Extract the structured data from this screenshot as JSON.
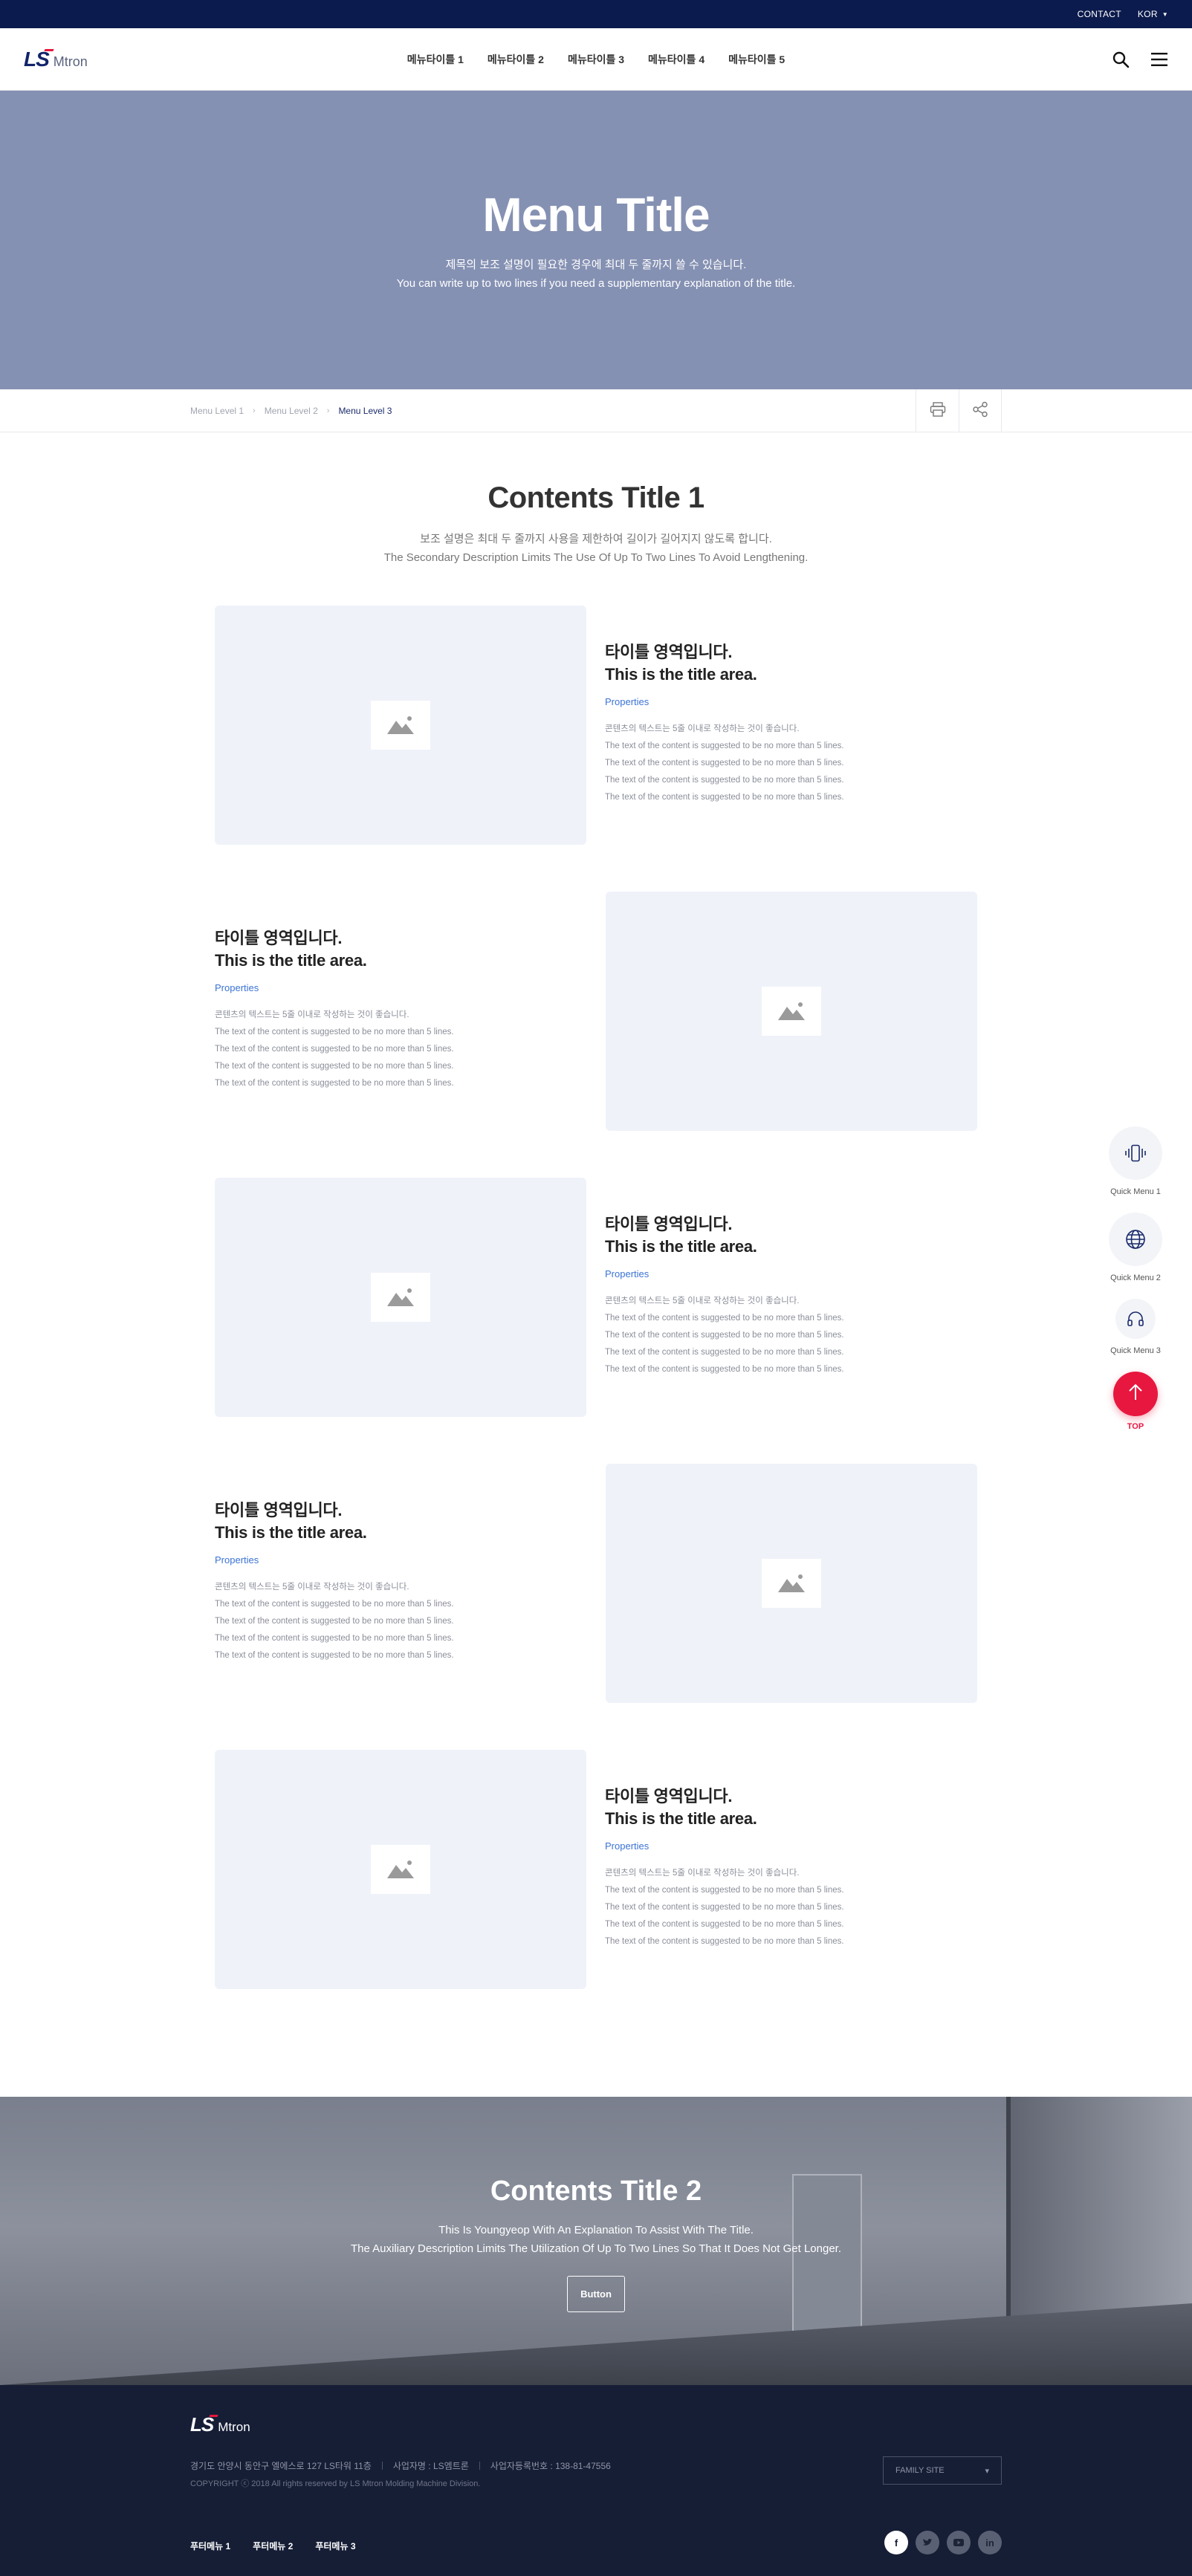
{
  "topbar": {
    "contact": "CONTACT",
    "language": "KOR"
  },
  "header": {
    "logo_mark": "LS",
    "logo_name": "Mtron",
    "menu": [
      "메뉴타이틀 1",
      "메뉴타이틀 2",
      "메뉴타이틀 3",
      "메뉴타이틀 4",
      "메뉴타이틀 5"
    ],
    "icons": [
      "search-icon",
      "hamburger-menu-icon"
    ]
  },
  "hero": {
    "title": "Menu Title",
    "desc_ko": "제목의 보조 설명이 필요한 경우에 최대 두 줄까지 쓸 수 있습니다.",
    "desc_en": "You can write up to two lines if you need a supplementary explanation of the title."
  },
  "breadcrumb": {
    "level1": "Menu Level 1",
    "level2": "Menu Level 2",
    "level3": "Menu Level 3",
    "tools": [
      "print-icon",
      "share-icon"
    ]
  },
  "section1": {
    "title": "Contents Title 1",
    "desc_ko": "보조 설명은 최대 두 줄까지 사용을 제한하여 길이가 길어지지 않도록 합니다.",
    "desc_en": "The Secondary Description Limits The Use Of Up To Two Lines To Avoid Lengthening.",
    "rows": [
      {
        "title_ko": "타이틀 영역입니다.",
        "title_en": "This is the title area.",
        "properties": "Properties",
        "lines": [
          "콘텐츠의 텍스트는 5줄 이내로 작성하는 것이 좋습니다.",
          "The text of the content is suggested to be no more than 5 lines.",
          "The text of the content is suggested to be no more than 5 lines.",
          "The text of the content is suggested to be no more than 5 lines.",
          "The text of the content is suggested to be no more than 5 lines."
        ]
      },
      {
        "title_ko": "타이틀 영역입니다.",
        "title_en": "This is the title area.",
        "properties": "Properties",
        "lines": [
          "콘텐츠의 텍스트는 5줄 이내로 작성하는 것이 좋습니다.",
          "The text of the content is suggested to be no more than 5 lines.",
          "The text of the content is suggested to be no more than 5 lines.",
          "The text of the content is suggested to be no more than 5 lines.",
          "The text of the content is suggested to be no more than 5 lines."
        ]
      },
      {
        "title_ko": "타이틀 영역입니다.",
        "title_en": "This is the title area.",
        "properties": "Properties",
        "lines": [
          "콘텐츠의 텍스트는 5줄 이내로 작성하는 것이 좋습니다.",
          "The text of the content is suggested to be no more than 5 lines.",
          "The text of the content is suggested to be no more than 5 lines.",
          "The text of the content is suggested to be no more than 5 lines.",
          "The text of the content is suggested to be no more than 5 lines."
        ]
      },
      {
        "title_ko": "타이틀 영역입니다.",
        "title_en": "This is the title area.",
        "properties": "Properties",
        "lines": [
          "콘텐츠의 텍스트는 5줄 이내로 작성하는 것이 좋습니다.",
          "The text of the content is suggested to be no more than 5 lines.",
          "The text of the content is suggested to be no more than 5 lines.",
          "The text of the content is suggested to be no more than 5 lines.",
          "The text of the content is suggested to be no more than 5 lines."
        ]
      },
      {
        "title_ko": "타이틀 영역입니다.",
        "title_en": "This is the title area.",
        "properties": "Properties",
        "lines": [
          "콘텐츠의 텍스트는 5줄 이내로 작성하는 것이 좋습니다.",
          "The text of the content is suggested to be no more than 5 lines.",
          "The text of the content is suggested to be no more than 5 lines.",
          "The text of the content is suggested to be no more than 5 lines.",
          "The text of the content is suggested to be no more than 5 lines."
        ]
      }
    ]
  },
  "section2": {
    "title": "Contents Title 2",
    "desc1": "This Is Youngyeop With An Explanation To Assist With The Title.",
    "desc2": "The Auxiliary Description Limits The Utilization Of Up To Two Lines So That It Does Not Get Longer.",
    "button": "Button"
  },
  "footer": {
    "logo_mark": "LS",
    "logo_name": "Mtron",
    "address": "경기도 안양시 동안구 엘에스로 127 LS타워 11층",
    "ceo": "사업자명 : LS엠트론",
    "biz_no": "사업자등록번호 : 138-81-47556",
    "copyright": "COPYRIGHT ⓒ 2018 All rights reserved by LS Mtron Molding Machine Division.",
    "family_site": "FAMILY SITE",
    "links": [
      "푸터메뉴 1",
      "푸터메뉴 2",
      "푸터메뉴 3"
    ],
    "social": [
      "facebook-icon",
      "twitter-icon",
      "youtube-icon",
      "linkedin-icon"
    ]
  },
  "quick_menu": {
    "items": [
      "Quick Menu 1",
      "Quick Menu 2",
      "Quick Menu 3"
    ],
    "top": "TOP"
  },
  "colors": {
    "navy": "#0c1b4d",
    "hero": "#8591b3",
    "accent_red": "#e8173f",
    "link_blue": "#3b73d4",
    "footer_bg": "#161e36"
  }
}
